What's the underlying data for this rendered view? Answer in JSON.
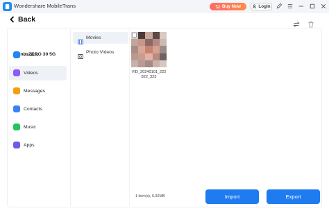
{
  "titlebar": {
    "app_title": "Wondershare MobileTrans",
    "buy_label": "Buy Now",
    "login_label": "Login"
  },
  "header": {
    "back_label": "Back"
  },
  "device": {
    "name": "Infinix ZERO 30 5G"
  },
  "sidebar": {
    "items": [
      {
        "label": "Photos",
        "icon": "photos-icon",
        "color": "#1e88f5"
      },
      {
        "label": "Videos",
        "icon": "videos-icon",
        "color": "#8b5cf6"
      },
      {
        "label": "Messages",
        "icon": "messages-icon",
        "color": "#f59e0b"
      },
      {
        "label": "Contacts",
        "icon": "contacts-icon",
        "color": "#3b82f6"
      },
      {
        "label": "Music",
        "icon": "music-icon",
        "color": "#22c55e"
      },
      {
        "label": "Apps",
        "icon": "apps-icon",
        "color": "#6d5ce8"
      }
    ]
  },
  "categories": {
    "items": [
      {
        "label": "Movies",
        "icon": "film-icon"
      },
      {
        "label": "Photo Videos",
        "icon": "photo-video-icon"
      }
    ]
  },
  "files": {
    "items": [
      {
        "name": "VID_20240101_222822_323"
      }
    ]
  },
  "footer": {
    "count_text": "1 item(s), 6.92MB",
    "import_label": "Import",
    "export_label": "Export"
  },
  "colors": {
    "accent": "#1e7bf0",
    "buy": "#ff6a6a"
  }
}
